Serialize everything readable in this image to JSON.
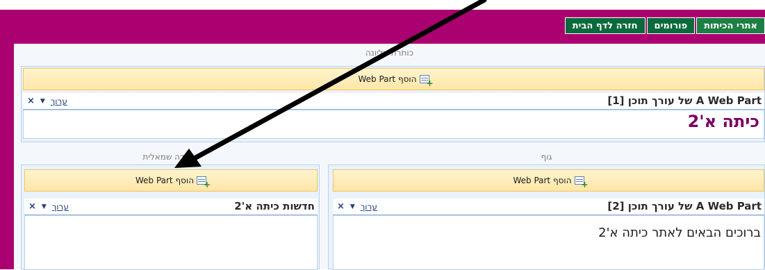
{
  "nav": {
    "tabs": [
      {
        "label": "אתרי הכיתות"
      },
      {
        "label": "פורומים"
      },
      {
        "label": "חזרה לדף הבית"
      }
    ]
  },
  "zones": {
    "header_label": "כותרת עליונה",
    "body_label": "גוף",
    "left_label": "עמודה שמאלית",
    "add_webpart": "הוסף Web Part"
  },
  "webparts": {
    "edit_label": "ערוך",
    "top": {
      "title": "A Web Part של עורך תוכן [1]",
      "heading": "כיתה א'2"
    },
    "body": {
      "title": "A Web Part של עורך תוכן [2]",
      "text": "ברוכים הבאים לאתר כיתה א'2"
    },
    "left": {
      "title": "חדשות כיתה א'2"
    }
  },
  "colors": {
    "brand_magenta": "#ab0070",
    "tab_green": "#0b6a3c",
    "add_bar": "#fee6a6",
    "heading_purple": "#7a0062"
  },
  "icons": {
    "add": "add-webpart-icon",
    "close": "close-icon",
    "menu": "dropdown-arrow-icon",
    "annotation": "arrow-annotation"
  }
}
